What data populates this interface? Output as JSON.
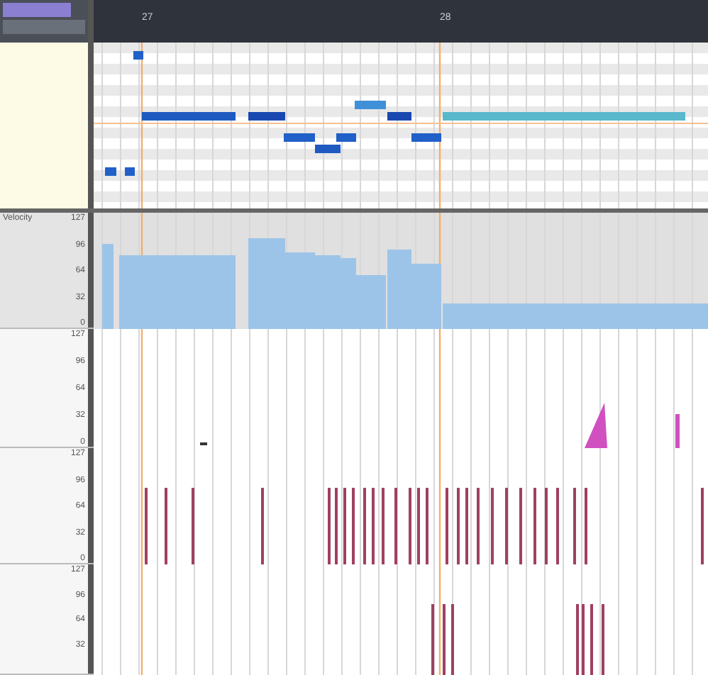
{
  "ruler": {
    "marks": [
      {
        "label": "27"
      },
      {
        "label": "28"
      }
    ]
  },
  "lanes": [
    {
      "kind": "velocity",
      "label": "Velocity",
      "ticks": [
        "127",
        "96",
        "64",
        "32",
        "0"
      ]
    },
    {
      "kind": "cc",
      "ticks": [
        "127",
        "96",
        "64",
        "32",
        "0"
      ]
    },
    {
      "kind": "cc",
      "ticks": [
        "127",
        "96",
        "64",
        "32",
        "0"
      ]
    },
    {
      "kind": "cc",
      "ticks": [
        "127",
        "96",
        "64",
        "32"
      ]
    }
  ]
}
